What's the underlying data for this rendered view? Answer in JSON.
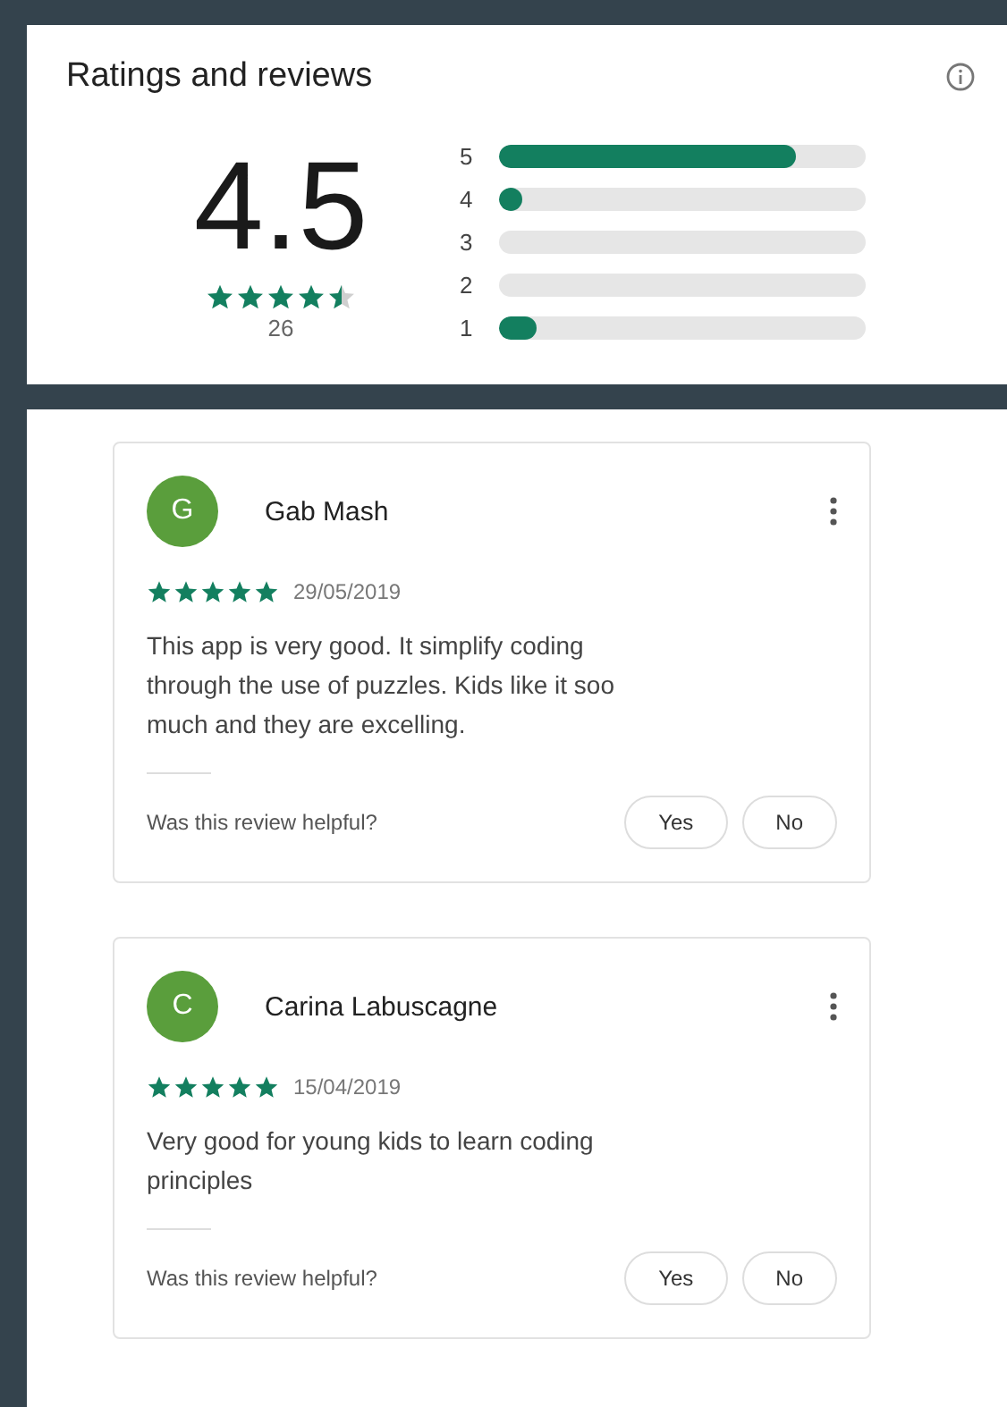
{
  "ratings": {
    "title": "Ratings and reviews",
    "average": "4.5",
    "stars": 4.5,
    "count": "26",
    "bars": [
      {
        "label": "5",
        "level": 0.81
      },
      {
        "label": "4",
        "level": 0.05
      },
      {
        "label": "3"
      },
      {
        "label": "2"
      },
      {
        "label": "1",
        "level": 0.1
      }
    ]
  },
  "reviews": [
    {
      "initial": "G",
      "color": "#5a9e3c",
      "name": "Gab Mash",
      "stars": 5,
      "date": "29/05/2019",
      "text": "This app is very good. It simplify coding through the use of puzzles. Kids like it soo much and they are excelling.",
      "question": "Was this review helpful?",
      "buttons": [
        "Yes",
        "No"
      ]
    },
    {
      "initial": "C",
      "color": "#5a9e3c",
      "name": "Carina Labuscagne",
      "stars": 5,
      "date": "15/04/2019",
      "text": "Very good for young kids to learn coding principles",
      "question": "Was this review helpful?",
      "buttons": [
        "Yes",
        "No"
      ]
    }
  ]
}
